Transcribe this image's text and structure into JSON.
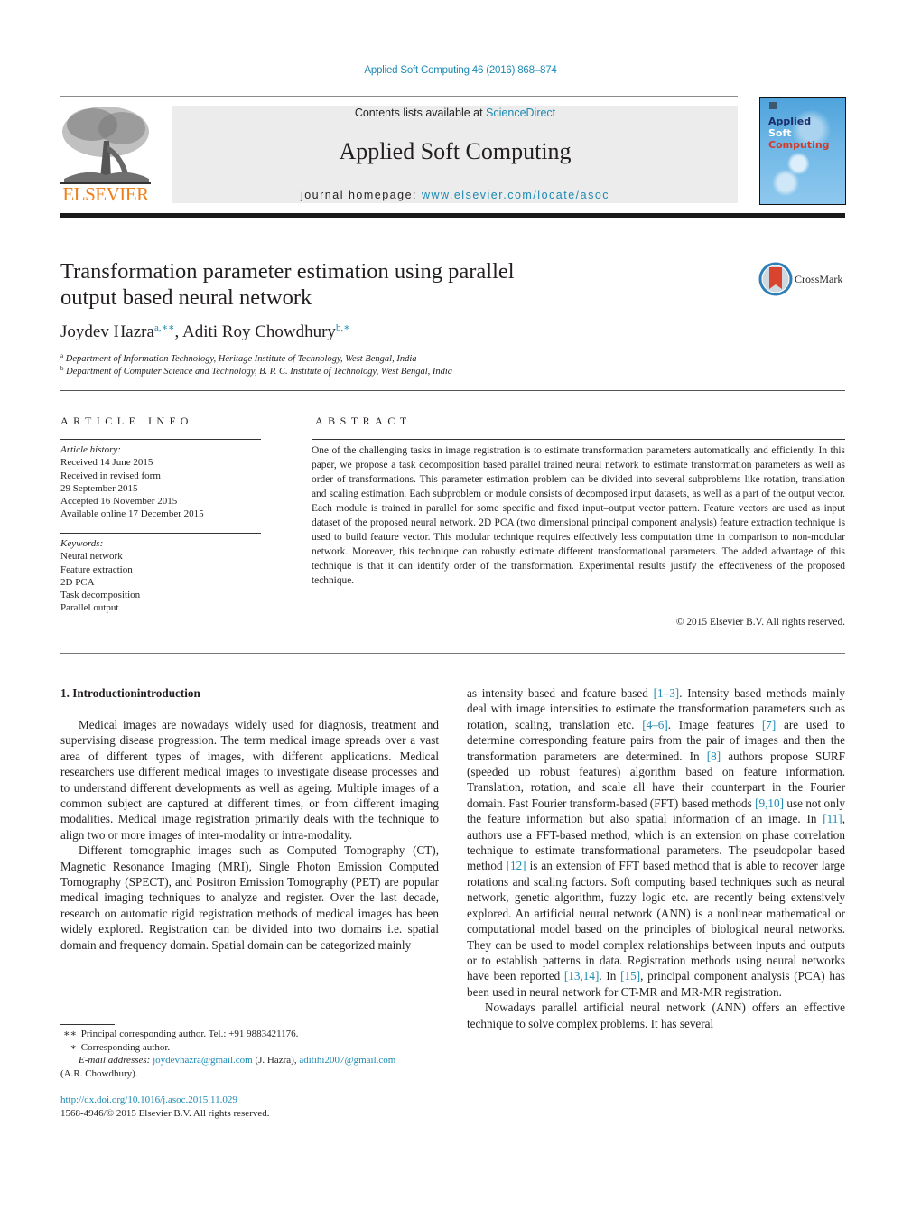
{
  "header": {
    "citation": "Applied Soft Computing 46 (2016) 868–874",
    "contents_prefix": "Contents lists available at ",
    "contents_link": "ScienceDirect",
    "journal_name": "Applied Soft Computing",
    "homepage_prefix": "journal homepage: ",
    "homepage_link": "www.elsevier.com/locate/asoc",
    "publisher_logo_text": "ELSEVIER",
    "cover": {
      "line1": "Applied",
      "line2": "Soft",
      "line3": "Computing"
    },
    "colors": {
      "link": "#1c8ab3",
      "elsevier_orange": "#f07f1b",
      "cover_blue": "#4fa3dc",
      "cover_red": "#d13b2b"
    }
  },
  "article": {
    "title_line1": "Transformation parameter estimation using parallel",
    "title_line2": "output based neural network",
    "crossmark_label": "CrossMark",
    "authors": [
      {
        "name": "Joydev Hazra",
        "sup": "a,∗∗"
      },
      {
        "name": "Aditi Roy Chowdhury",
        "sup": "b,∗"
      }
    ],
    "author_separator": ", ",
    "affiliations": [
      {
        "mark": "a",
        "text": "Department of Information Technology, Heritage Institute of Technology, West Bengal, India"
      },
      {
        "mark": "b",
        "text": "Department of Computer Science and Technology, B. P. C. Institute of Technology, West Bengal, India"
      }
    ]
  },
  "article_info": {
    "heading": "ARTICLE INFO",
    "history_label": "Article history:",
    "history": [
      "Received 14 June 2015",
      "Received in revised form",
      "29 September 2015",
      "Accepted 16 November 2015",
      "Available online 17 December 2015"
    ],
    "keywords_label": "Keywords:",
    "keywords": [
      "Neural network",
      "Feature extraction",
      "2D PCA",
      "Task decomposition",
      "Parallel output"
    ]
  },
  "abstract": {
    "heading": "ABSTRACT",
    "text": "One of the challenging tasks in image registration is to estimate transformation parameters automatically and efficiently. In this paper, we propose a task decomposition based parallel trained neural network to estimate transformation parameters as well as order of transformations. This parameter estimation problem can be divided into several subproblems like rotation, translation and scaling estimation. Each subproblem or module consists of decomposed input datasets, as well as a part of the output vector. Each module is trained in parallel for some specific and fixed input–output vector pattern. Feature vectors are used as input dataset of the proposed neural network. 2D PCA (two dimensional principal component analysis) feature extraction technique is used to build feature vector. This modular technique requires effectively less computation time in comparison to non-modular network. Moreover, this technique can robustly estimate different transformational parameters. The added advantage of this technique is that it can identify order of the transformation. Experimental results justify the effectiveness of the proposed technique.",
    "copyright": "© 2015 Elsevier B.V. All rights reserved."
  },
  "body": {
    "section_heading": "1.  Introductionintroduction",
    "left_paragraphs": [
      "Medical images are nowadays widely used for diagnosis, treatment and supervising disease progression. The term medical image spreads over a vast area of different types of images, with different applications. Medical researchers use different medical images to investigate disease processes and to understand different developments as well as ageing. Multiple images of a common subject are captured at different times, or from different imaging modalities. Medical image registration primarily deals with the technique to align two or more images of inter-modality or intra-modality.",
      "Different tomographic images such as Computed Tomography (CT), Magnetic Resonance Imaging (MRI), Single Photon Emission Computed Tomography (SPECT), and Positron Emission Tomography (PET) are popular medical imaging techniques to analyze and register. Over the last decade, research on automatic rigid registration methods of medical images has been widely explored. Registration can be divided into two domains i.e. spatial domain and frequency domain. Spatial domain can be categorized mainly"
    ],
    "right": {
      "p1": [
        {
          "t": "as intensity based and feature based "
        },
        {
          "ref": "[1–3]"
        },
        {
          "t": ". Intensity based methods mainly deal with image intensities to estimate the transformation parameters such as rotation, scaling, translation etc. "
        },
        {
          "ref": "[4–6]"
        },
        {
          "t": ". Image features "
        },
        {
          "ref": "[7]"
        },
        {
          "t": " are used to determine corresponding feature pairs from the pair of images and then the transformation parameters are determined. In "
        },
        {
          "ref": "[8]"
        },
        {
          "t": " authors propose SURF (speeded up robust features) algorithm based on feature information. Translation, rotation, and scale all have their counterpart in the Fourier domain. Fast Fourier transform-based (FFT) based methods "
        },
        {
          "ref": "[9,10]"
        },
        {
          "t": " use not only the feature information but also spatial information of an image. In "
        },
        {
          "ref": "[11]"
        },
        {
          "t": ", authors use a FFT-based method, which is an extension on phase correlation technique to estimate transformational parameters. The pseudopolar based method "
        },
        {
          "ref": "[12]"
        },
        {
          "t": " is an extension of FFT based method that is able to recover large rotations and scaling factors. Soft computing based techniques such as neural network, genetic algorithm, fuzzy logic etc. are recently being extensively explored. An artificial neural network (ANN) is a nonlinear mathematical or computational model based on the principles of biological neural networks. They can be used to model complex relationships between inputs and outputs or to establish patterns in data. Registration methods using neural networks have been reported "
        },
        {
          "ref": "[13,14]"
        },
        {
          "t": ". In "
        },
        {
          "ref": "[15]"
        },
        {
          "t": ", principal component analysis (PCA) has been used in neural network for CT-MR and MR-MR registration."
        }
      ],
      "p2": "Nowadays parallel artificial neural network (ANN) offers an effective technique to solve complex problems. It has several"
    }
  },
  "footnotes": {
    "principal_mark": "∗∗",
    "principal_text": "Principal corresponding author. Tel.: +91 9883421176.",
    "corr_mark": "∗",
    "corr_text": "Corresponding author.",
    "email_label": "E-mail addresses: ",
    "email1": "joydevhazra@gmail.com",
    "email1_owner": " (J. Hazra), ",
    "email2": "aditihi2007@gmail.com",
    "email2_owner": "(A.R. Chowdhury).",
    "doi": "http://dx.doi.org/10.1016/j.asoc.2015.11.029",
    "issn_line": "1568-4946/© 2015 Elsevier B.V. All rights reserved."
  }
}
